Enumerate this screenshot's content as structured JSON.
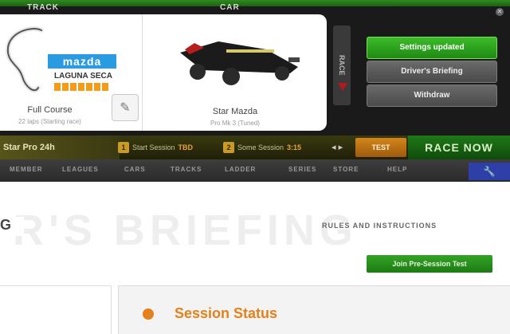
{
  "top": {
    "left_label": "TRACK",
    "right_label": "CAR"
  },
  "track": {
    "title": "Full Course",
    "subtitle": "22 laps (Starting race)",
    "logo_brand": "mazda",
    "logo_sub": "LAGUNA SECA"
  },
  "car": {
    "title": "Star Mazda",
    "subtitle": "Pro Mk 3 (Tuned)"
  },
  "side": {
    "vertical_label": "RACE"
  },
  "menu": {
    "settings": "Settings updated",
    "middle": "Driver's Briefing",
    "lower": "Withdraw"
  },
  "race": {
    "info": "Star Pro 24h",
    "slot1": {
      "num": "1",
      "label": "Start Session",
      "value": "TBD"
    },
    "slot2": {
      "num": "2",
      "label": "Some Session",
      "value": "3:15"
    },
    "test": "TEST",
    "race_now": "RACE NOW"
  },
  "nav": {
    "items": [
      "MEMBER",
      "LEAGUES",
      "CARS",
      "TRACKS",
      "LADDER",
      "SERIES",
      "STORE",
      "HELP"
    ]
  },
  "content": {
    "title": "R'S BRIEFING",
    "badge": "G",
    "rules": "RULES AND INSTRUCTIONS",
    "join_btn": "Join Pre-Session Test",
    "box_title": "Session Status"
  },
  "colors": {
    "green": "#2e9e22",
    "orange": "#e6801a",
    "dark": "#1a1a1a"
  }
}
